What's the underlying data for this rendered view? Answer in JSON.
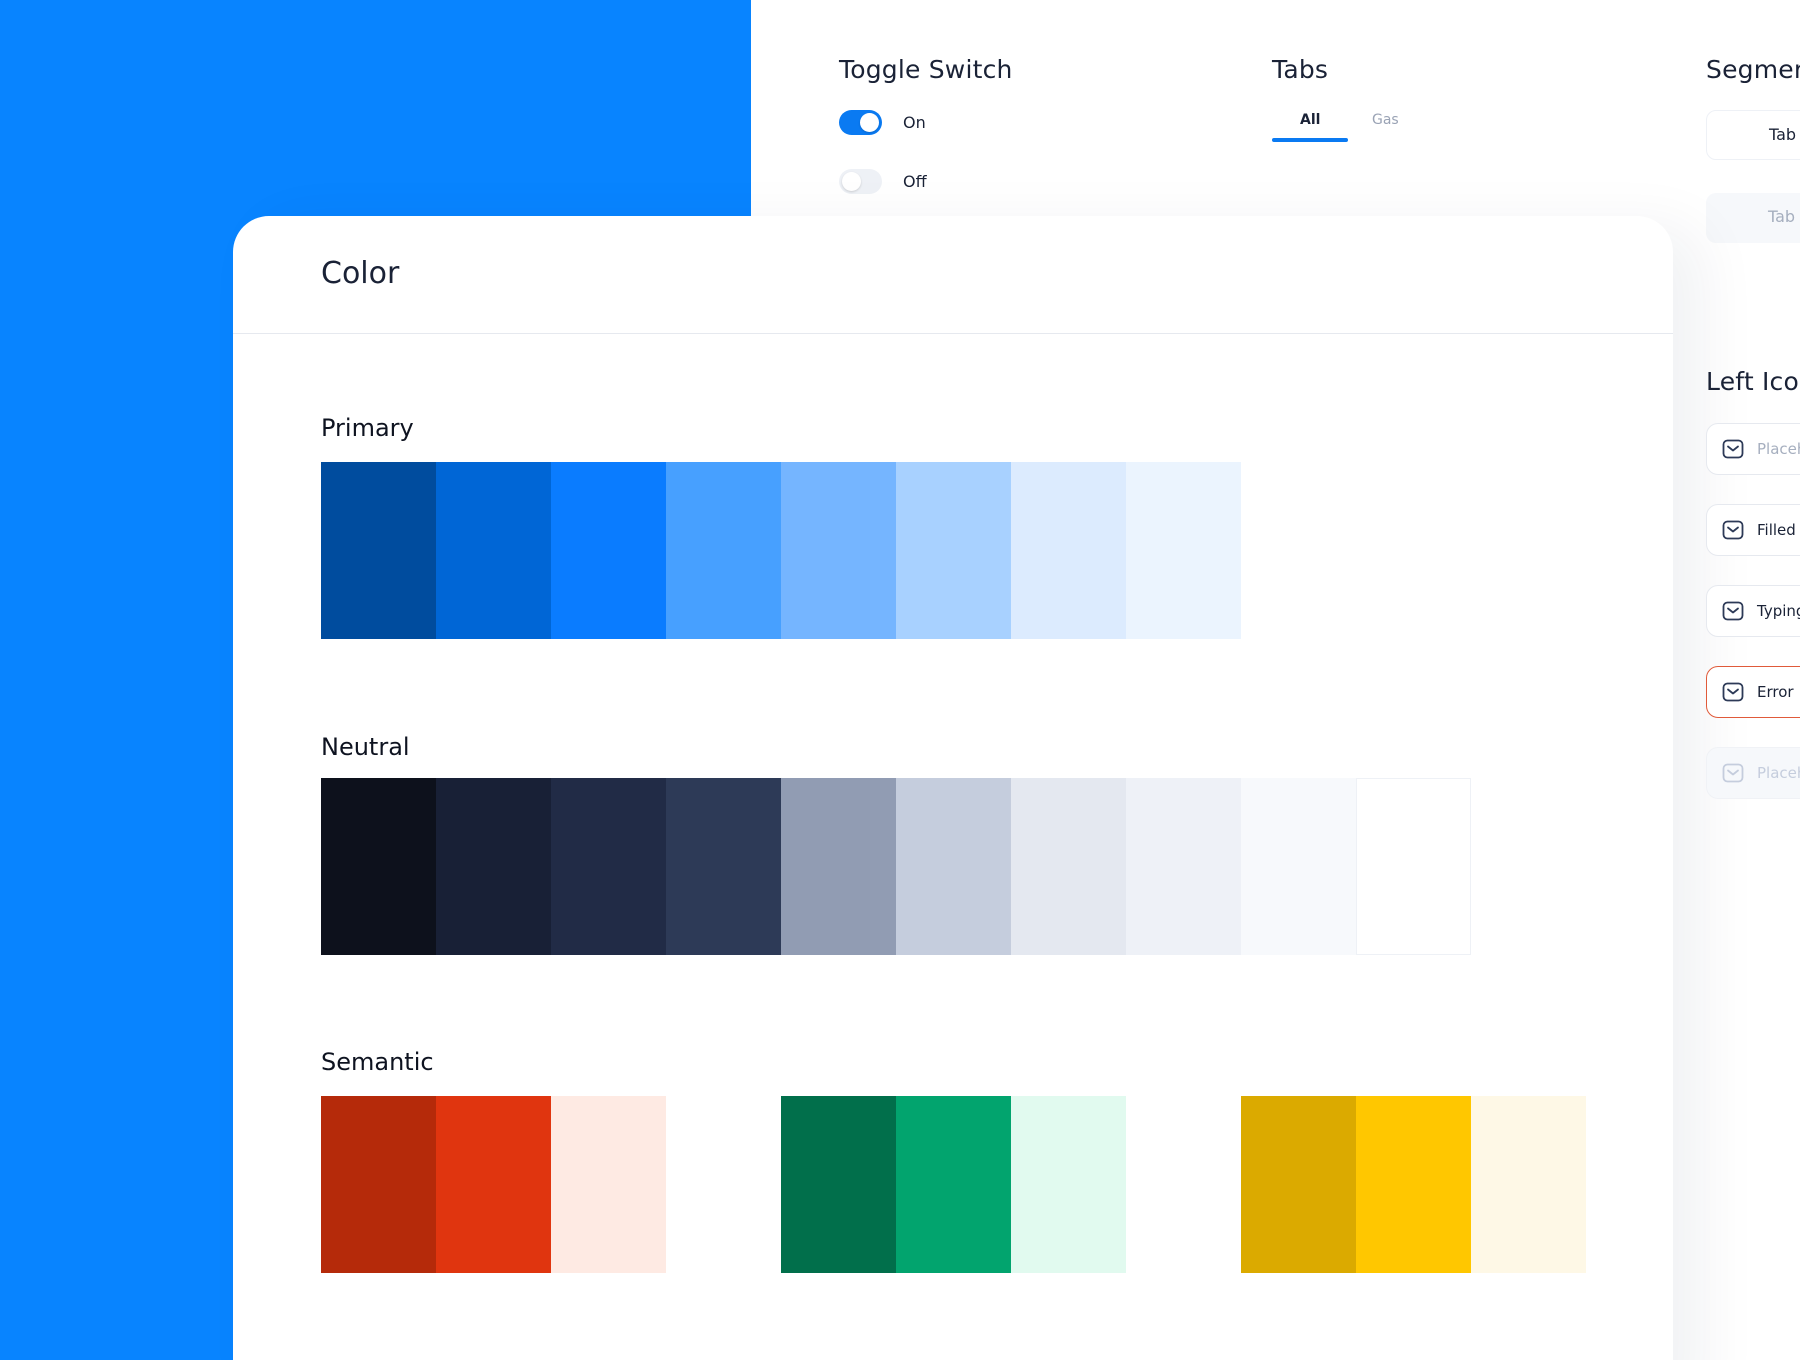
{
  "toggle_section": {
    "title": "Toggle Switch",
    "on_label": "On",
    "off_label": "Off"
  },
  "tabs_section": {
    "title": "Tabs",
    "tabs": [
      {
        "label": "All",
        "active": true
      },
      {
        "label": "Gas",
        "active": false
      }
    ]
  },
  "segmented_section": {
    "title": "Segmen",
    "items": [
      {
        "label": "Tab",
        "state": "selected"
      },
      {
        "label": "Tab",
        "state": "unselected"
      }
    ]
  },
  "left_icon_section": {
    "title": "Left Icon",
    "fields": [
      {
        "text": "Placeh",
        "state": "placeholder"
      },
      {
        "text": "Filled",
        "state": "filled"
      },
      {
        "text": "Typing",
        "state": "typing"
      },
      {
        "text": "Error",
        "state": "error"
      },
      {
        "text": "Placeh",
        "state": "disabled"
      }
    ]
  },
  "color_card": {
    "title": "Color",
    "primary": {
      "title": "Primary",
      "swatches": [
        "#004C9E",
        "#0066D6",
        "#0A7CFF",
        "#47A0FF",
        "#75B5FF",
        "#A8D1FF",
        "#DCEBFE",
        "#EBF4FE"
      ]
    },
    "neutral": {
      "title": "Neutral",
      "swatches": [
        "#0D111C",
        "#182036",
        "#212B46",
        "#2D3A57",
        "#919CB3",
        "#C5CDDD",
        "#E4E8F0",
        "#EEF1F7",
        "#F7F9FC",
        "#FFFFFF"
      ]
    },
    "semantic": {
      "title": "Semantic",
      "groups": [
        [
          "#B52A0A",
          "#E0350F",
          "#FEEAE3"
        ],
        [
          "#016F4B",
          "#02A46E",
          "#E1FAEF"
        ],
        [
          "#DBAA00",
          "#FFC700",
          "#FEF8E6"
        ]
      ]
    }
  }
}
